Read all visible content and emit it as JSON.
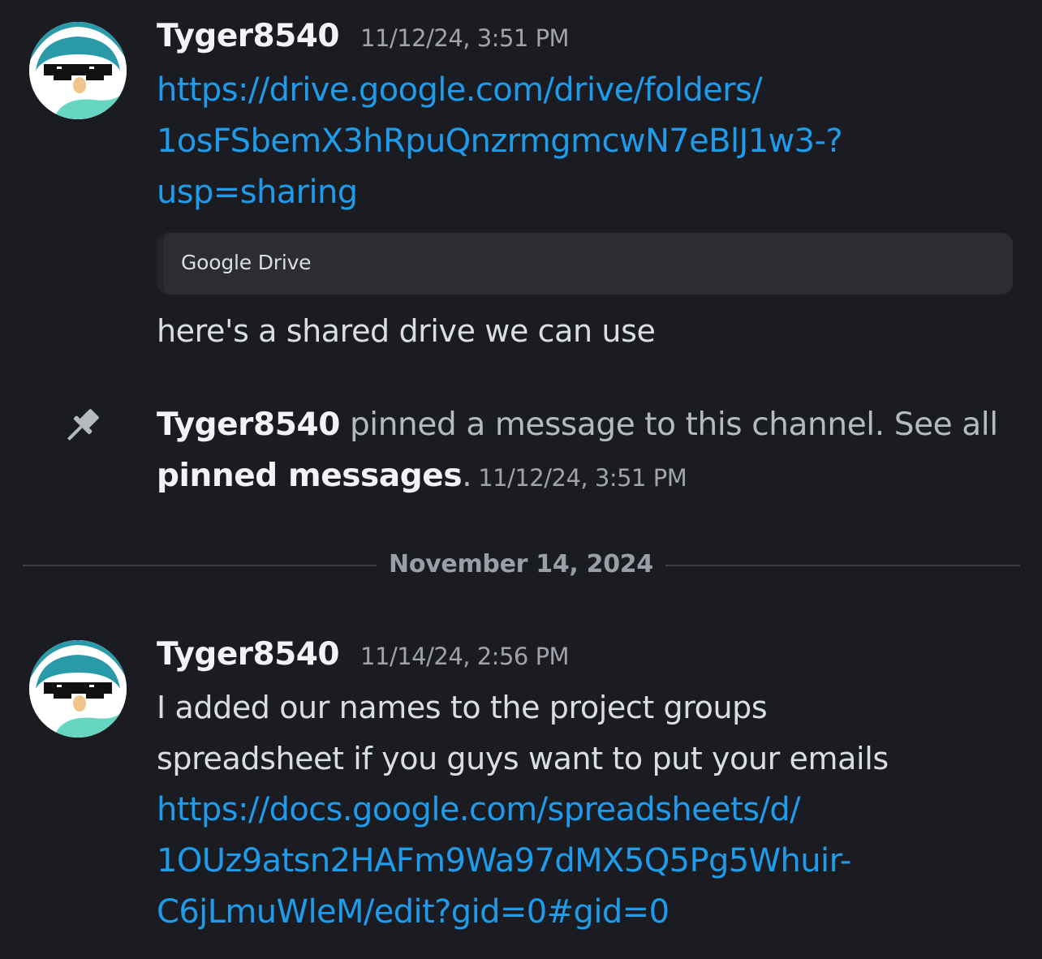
{
  "messages": [
    {
      "username": "Tyger8540",
      "timestamp": "11/12/24, 3:51 PM",
      "link_lines": [
        "https://drive.google.com/drive/folders/",
        "1osFSbemX3hRpuQnzrmgmcwN7eBlJ1w3-?",
        "usp=sharing"
      ],
      "embed_provider": "Google Drive",
      "text": "here's a shared drive we can use"
    },
    {
      "username": "Tyger8540",
      "timestamp": "11/14/24, 2:56 PM",
      "text_lines": [
        "I added our names to the project groups",
        "spreadsheet if you guys want to put your emails"
      ],
      "link_lines": [
        "https://docs.google.com/spreadsheets/d/",
        "1OUz9atsn2HAFm9Wa97dMX5Q5Pg5Whuir-",
        "C6jLmuWleM/edit?gid=0#gid=0"
      ]
    }
  ],
  "system_message": {
    "icon": "pin-icon",
    "username": "Tyger8540",
    "text_before": " pinned a message to this channel. See all ",
    "link_text": "pinned messages",
    "text_after": ".",
    "timestamp": "11/12/24, 3:51 PM"
  },
  "date_divider": "November 14, 2024",
  "colors": {
    "background": "#1b1c21",
    "link": "#1e9bea",
    "username": "#f2f3f5",
    "timestamp": "#a0a3ab",
    "embed_background": "#2b2d31"
  }
}
